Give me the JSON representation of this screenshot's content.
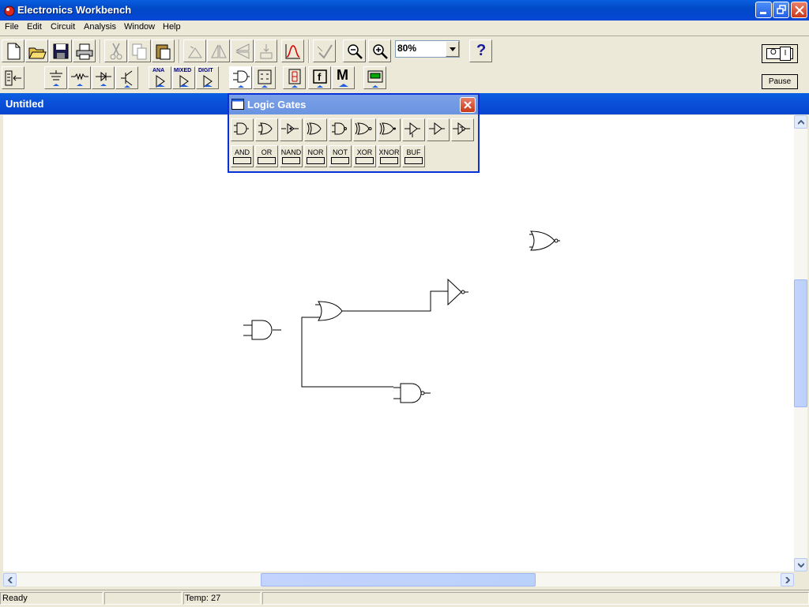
{
  "window": {
    "title": "Electronics Workbench"
  },
  "menu": [
    "File",
    "Edit",
    "Circuit",
    "Analysis",
    "Window",
    "Help"
  ],
  "toolbar": {
    "zoom": "80%",
    "help": "?",
    "part_bins": {
      "analog": "ANA",
      "mixed": "MIXED",
      "digital": "DIGIT",
      "measure": "M"
    }
  },
  "sim": {
    "pause": "Pause",
    "switch_off": "O",
    "switch_on": "I"
  },
  "document": {
    "title": "Untitled"
  },
  "palette": {
    "title": "Logic Gates",
    "labels": [
      "AND",
      "OR",
      "NAND",
      "NOR",
      "NOT",
      "XOR",
      "XNOR",
      "BUF"
    ]
  },
  "status": {
    "ready": "Ready",
    "temp": "Temp:  27"
  },
  "colors": {
    "titlebar": "#0549d6",
    "palette_title": "#7ba2e7",
    "canvas": "#ffffff"
  }
}
